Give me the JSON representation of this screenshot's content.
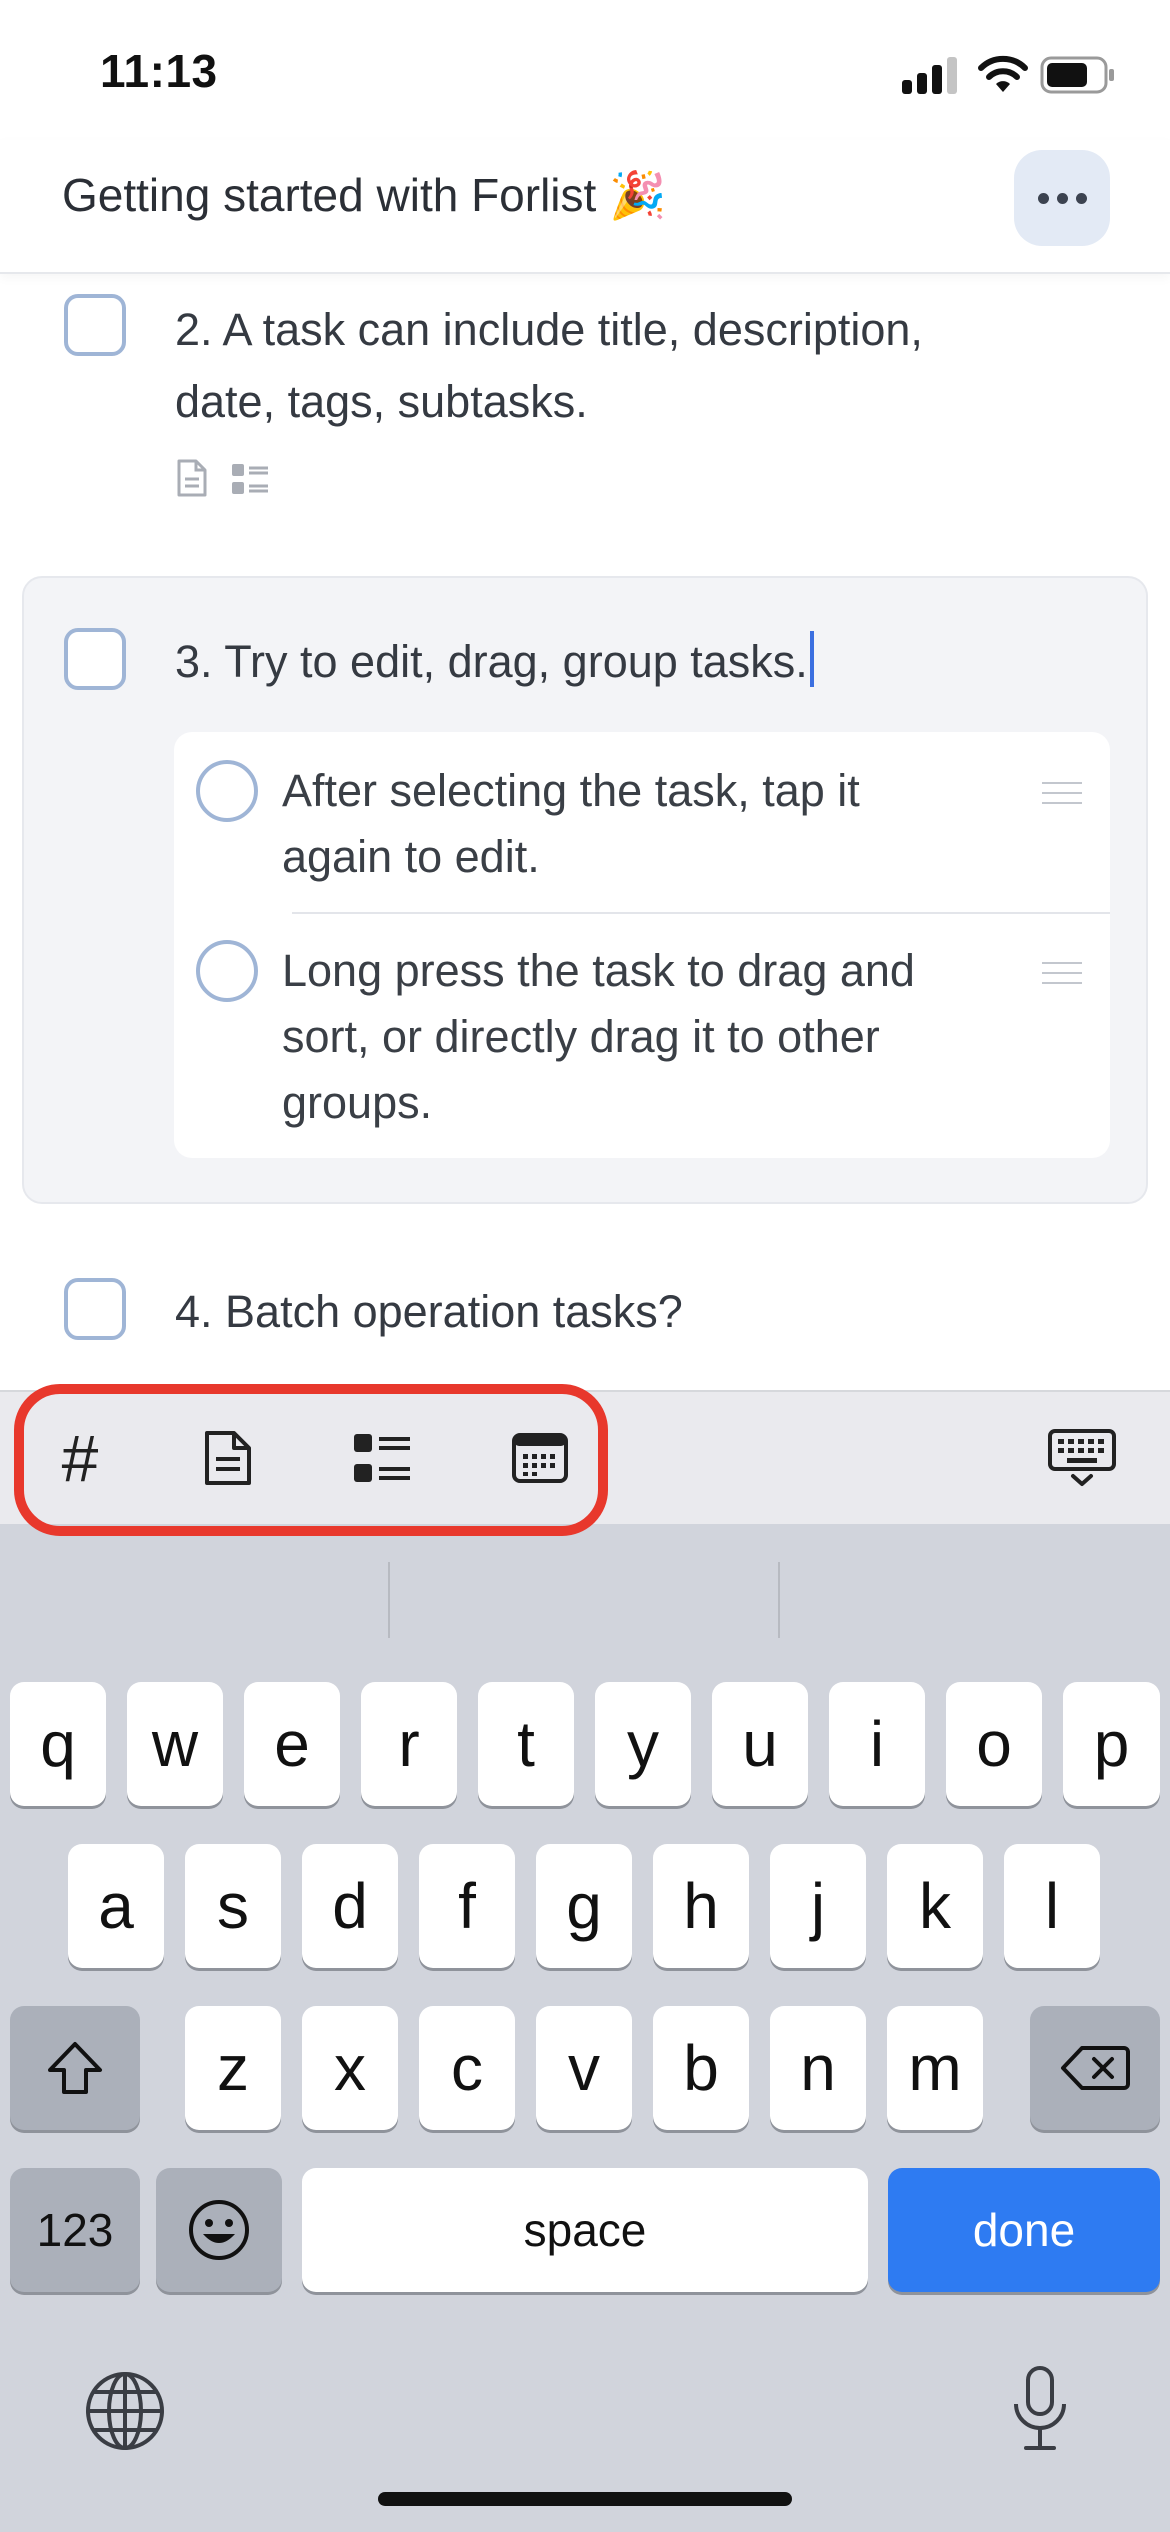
{
  "status_bar": {
    "time": "11:13"
  },
  "header": {
    "title": "Getting started with Forlist 🎉"
  },
  "tasks": [
    {
      "title_line1": "2. A task can include title, description,",
      "title_line2": "date, tags, subtasks."
    },
    {
      "title": "3. Try to edit, drag, group tasks."
    },
    {
      "title": "4. Batch operation tasks?"
    }
  ],
  "subtasks": [
    {
      "line1": "After selecting the task, tap it",
      "line2": "again to edit."
    },
    {
      "line1": "Long press the task to drag and",
      "line2": "sort, or directly drag it to other",
      "line3": "groups."
    }
  ],
  "toolbar": {
    "tag_symbol": "#"
  },
  "keyboard": {
    "row1": [
      "q",
      "w",
      "e",
      "r",
      "t",
      "y",
      "u",
      "i",
      "o",
      "p"
    ],
    "row2": [
      "a",
      "s",
      "d",
      "f",
      "g",
      "h",
      "j",
      "k",
      "l"
    ],
    "row3": [
      "z",
      "x",
      "c",
      "v",
      "b",
      "n",
      "m"
    ],
    "numbers_key": "123",
    "space_key": "space",
    "done_key": "done"
  },
  "colors": {
    "accent": "#2e7bf2",
    "highlight": "#e8382c",
    "checkbox_border": "#9fb5d6"
  }
}
